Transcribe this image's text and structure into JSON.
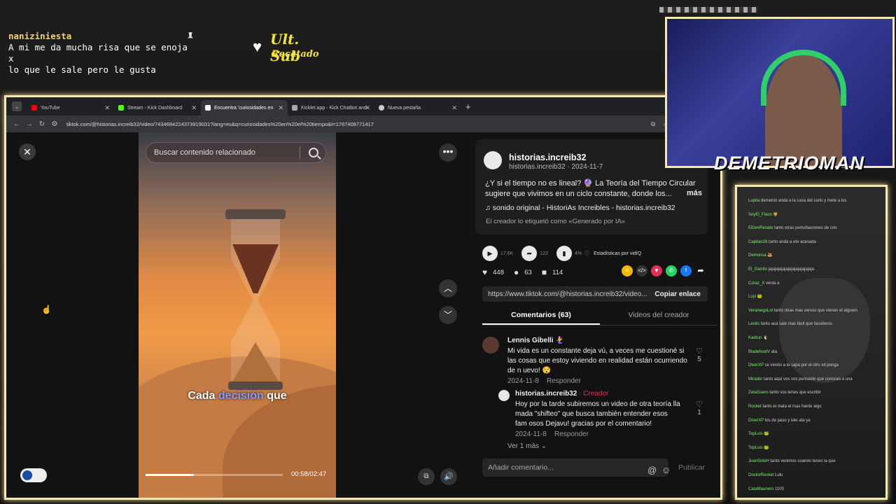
{
  "overlay": {
    "chat_user": "naniziniesta",
    "chat_message": "A mi me da mucha risa que se enoja x\nlo que le sale pero le gusta",
    "sub_title": "Ult. Sub",
    "sub_name": "Recatado"
  },
  "browser": {
    "tabs": [
      {
        "label": "YouTube",
        "color": "#ff0000",
        "active": false
      },
      {
        "label": "Stream - Kick Dashboard",
        "color": "#53fc18",
        "active": false
      },
      {
        "label": "Encuentra 'curiosidades en",
        "color": "#ffffff",
        "active": true
      },
      {
        "label": "Kicklet.app - Kick Chatbot and",
        "color": "#aaaaaa",
        "active": false
      },
      {
        "label": "Nueva pestaña",
        "color": "#cccccc",
        "active": false
      }
    ],
    "url": "tiktok.com/@historias.increib32/video/7434684224373919031?lang=es&q=curiosidades%20en%20el%20tiempo&t=1767408771417"
  },
  "video": {
    "search_placeholder": "Buscar contenido relacionado",
    "caption_pre": "Cada ",
    "caption_highlight": "decisión",
    "caption_post": " que",
    "time": "00:58/02:47",
    "progress": 0.35
  },
  "post": {
    "author": "historias.increib32",
    "author_sub": "historias.increib32 · 2024-11-7",
    "description": "¿Y si el tiempo no es lineal? 🔮 La Teoría del Tiempo Circular sugiere que vivimos en un ciclo constante, donde los...",
    "more": "más",
    "sound": "♫  sonido original - HistoriAs Increibles - historias.increib32",
    "ai_label": "El creador lo etiquetó como «Generado por IA»",
    "plays": "17.6K",
    "shares_stat": "122",
    "percent": "4%",
    "stats_label": "Estadísticas por vidIQ",
    "likes": "448",
    "comments": "63",
    "saves": "114",
    "link": "https://www.tiktok.com/@historias.increib32/video...",
    "copy_link": "Copiar enlace",
    "tab_comments": "Comentarios (63)",
    "tab_videos": "Videos del creador",
    "see_more": "Ver 1 más ⌄",
    "add_comment": "Añadir comentario...",
    "publish": "Publicar"
  },
  "comments": [
    {
      "name": "Lennis Gibelli 🧜‍♀️",
      "text": "Mi vida es un constante deja vú, a veces me cuestioné si las cosas que estoy viviendo en realidad están ocurriendo de n uevo! 😯",
      "date": "2024-11-8",
      "reply": "Responder",
      "likes": "5"
    },
    {
      "name": "historias.increib32",
      "creator": " · Creador",
      "text": "Hoy por la tarde subiremos un video de otra teoría lla mada \"shifteo\" que busca también entender esos fam osos Dejavu! gracias por el comentario!",
      "date": "2024-11-8",
      "reply": "Responder",
      "likes": "1"
    }
  ],
  "cam": {
    "name": "DEMETRIOMAN"
  },
  "chat": [
    {
      "u": "Lupita",
      "m": "demetrio anda a la casa del carlo y mete a los"
    },
    {
      "u": "SoyEl_Flaco",
      "m": "🦁"
    },
    {
      "u": "ElDevRenato",
      "m": "tanto otras perturbaciones de con"
    },
    {
      "u": "Capitan26",
      "m": "tanto anda a ete acesada"
    },
    {
      "u": "Demonsa",
      "m": "🦊"
    },
    {
      "u": "El_Garrito",
      "m": "jajajajajajajajajajajajajaja"
    },
    {
      "u": "Coraz_X",
      "m": "venia a"
    },
    {
      "u": "Luyi",
      "m": "🐸"
    },
    {
      "u": "VeraniegoLol",
      "m": "tanto otras mas versos que vienen el alguien"
    },
    {
      "u": "Lexito",
      "m": "tanto acá sale mas fácil que faculteros"
    },
    {
      "u": "Kadrun",
      "m": "🐧"
    },
    {
      "u": "BladehootV",
      "m": "ata"
    },
    {
      "u": "DiverXP",
      "m": "se vendo a la sapa por el otro xd ponga"
    },
    {
      "u": "Mirador",
      "m": "tanto aqui vos vos pensaste que conoces a una"
    },
    {
      "u": "ZetaGuero",
      "m": "tanto vos tenes que escribir"
    },
    {
      "u": "Rocket",
      "m": "tanto ei mata el mas fuerte algo"
    },
    {
      "u": "DiverXP",
      "m": "tos de paso y tele ata ya"
    },
    {
      "u": "TopLuis",
      "m": "🐸"
    },
    {
      "u": "TopLuis",
      "m": "🐸"
    },
    {
      "u": "JuanSotoH",
      "m": "tanto venimos cuando tenes la que"
    },
    {
      "u": "DoctorRocket",
      "m": "Lulu"
    },
    {
      "u": "CataMaunero",
      "m": "1100"
    }
  ]
}
